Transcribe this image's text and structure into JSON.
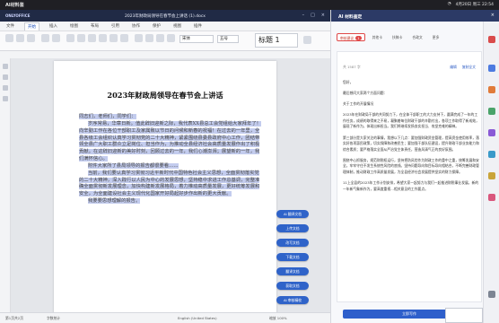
{
  "topbar": {
    "app_name": "AI材料鉴",
    "time": "4月20日 周三 22:54"
  },
  "titlebar": {
    "logo": "ONLYOFFICE",
    "doc_title": "2023年财政局领导在春节会上讲话 (1).docx"
  },
  "menu": [
    "文件",
    "开始",
    "插入",
    "绘图",
    "布局",
    "引用",
    "协作",
    "保护",
    "视图",
    "插件"
  ],
  "ribbon": {
    "font_name": "宋体",
    "font_size": "五号",
    "style_preview": "标题 1"
  },
  "document": {
    "title": "2023年财政局领导在春节会上讲话",
    "paragraphs": [
      "同志们，老师们，同学们：",
      "岁序常易，华章日新。值此辞旧迎新之际，我代表XX县总工会党组给大家拜年了！向辛勤工作在各位干部职工及家属致以节日的问候和新春的祝福！在过去的一年里，全县各级工会组织认真学习贯彻党的二十大精神，紧紧围绕县委县政府中心工作，团结带领全县广大职工群众立足岗位、担当作为，为推动全县经济社会高质量发展作出了积极贡献。在这辞旧迎新的美好时刻，回顾过去的一年，我们心潮澎湃；展望新的一年，我们满怀信心。",
      "附件大家所了县局领导的报告都很要看……",
      "当前，我们要认真学习贯彻习近平新时代中国特色社会主义思想，全面贯彻落实党的二十大精神，深入践行以人民为中心的发展思想，坚持稳中求进工作总基调，完整准确全面贯彻新发展理念，加快构建新发展格局，着力推动高质量发展，更好统筹发展和安全，为全面建设社会主义现代化国家开好局起好步作出新的更大贡献。",
      "我要要思想理解的报告。"
    ]
  },
  "float_menu": [
    "AI 翻译文档",
    "上传文档",
    "改写文档",
    "下载文档",
    "翻译文档",
    "获取文档",
    "AI 审核精校"
  ],
  "statusbar": {
    "page": "第1页共2页",
    "words": "字数统计",
    "language": "English (United States)",
    "zoom": "缩放 100%"
  },
  "panel": {
    "title": "AI 材料鉴定",
    "tabs": [
      {
        "label": "审核建议",
        "badge": "1"
      },
      {
        "label": "其他卡"
      },
      {
        "label": "扶稿卡"
      },
      {
        "label": "合政文"
      },
      {
        "label": "更多"
      }
    ],
    "meta": "共 1587 字",
    "actions": [
      "编辑",
      "复制全文"
    ],
    "paragraphs": [
      "您好，",
      "最后想问大家两个方面问题：",
      "关于工作的开展情况",
      "2023年在财政局干部的共同努力下，在全体干部职工的大力支持下，圆满完成了一年的工作任务，成绩的取得来之不易，凝聚着每位财政干部的辛勤付出，各项工作取得了新成效，展现了新作为，体现出新担当。我们将继续发扬务实担当、攻坚克难的精神。",
      "第三部分是大家关注的事情，我想以下几点：要加强财政资金管理，提高资金使用效率，落实好各项惠民政策，切实保障和改善民生；要加强干部队伍建设，提升财政干部业务能力和综合素质；要严格落实全面从严治党主体责任，营造风清气正的良好氛围。",
      "围绕中心抓服务，规范财税权运行，坚持把防风险作为财政工作的重中之重，统筹发展和安全，牢牢守住不发生系统性风险的底线。坚持问题导向和目标导向相结合，不断完善财政管理体制，推动财政工作高质量发展，为全县经济社会发展提供坚实的财力保障。",
      "11上全县的2023年工作计划安排，希望大家一起努力与我们一起推进财税事业发展，新的一年新气象新作为，要高度重视…相关意见的工作要点。"
    ],
    "button": "立即写作"
  }
}
